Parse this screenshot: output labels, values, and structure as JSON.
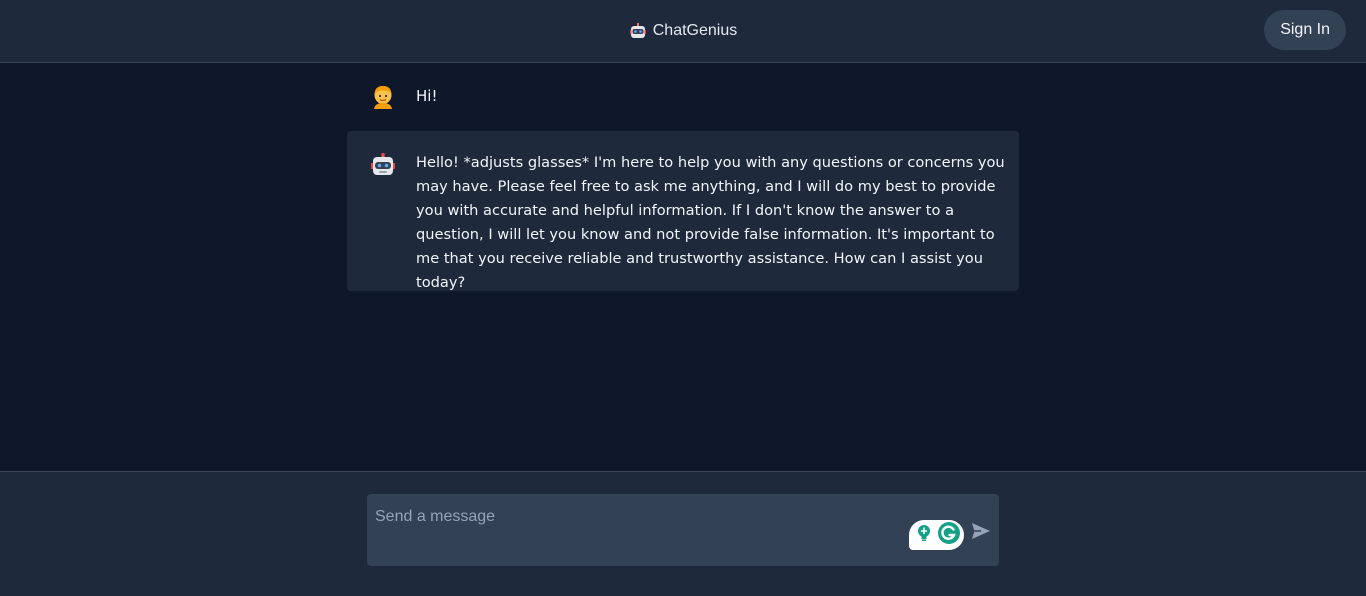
{
  "app": {
    "title": "ChatGenius",
    "logo_icon": "robot-icon"
  },
  "header": {
    "sign_in_label": "Sign In"
  },
  "messages": [
    {
      "role": "user",
      "avatar_icon": "person-emoji-icon",
      "text": "Hi!"
    },
    {
      "role": "assistant",
      "avatar_icon": "robot-icon",
      "text": "Hello! *adjusts glasses* I'm here to help you with any questions or concerns you may have. Please feel free to ask me anything, and I will do my best to provide you with accurate and helpful information. If I don't know the answer to a question, I will let you know and not provide false information. It's important to me that you receive reliable and trustworthy assistance. How can I assist you today?"
    }
  ],
  "composer": {
    "placeholder": "Send a message",
    "value": "",
    "extension_icons": [
      "bulb-icon",
      "grammarly-icon"
    ],
    "send_icon": "send-arrow-icon"
  },
  "colors": {
    "page_bg": "#0f172a",
    "panel_bg": "#1e293b",
    "input_bg": "#334155",
    "accent_green": "#15a185"
  }
}
